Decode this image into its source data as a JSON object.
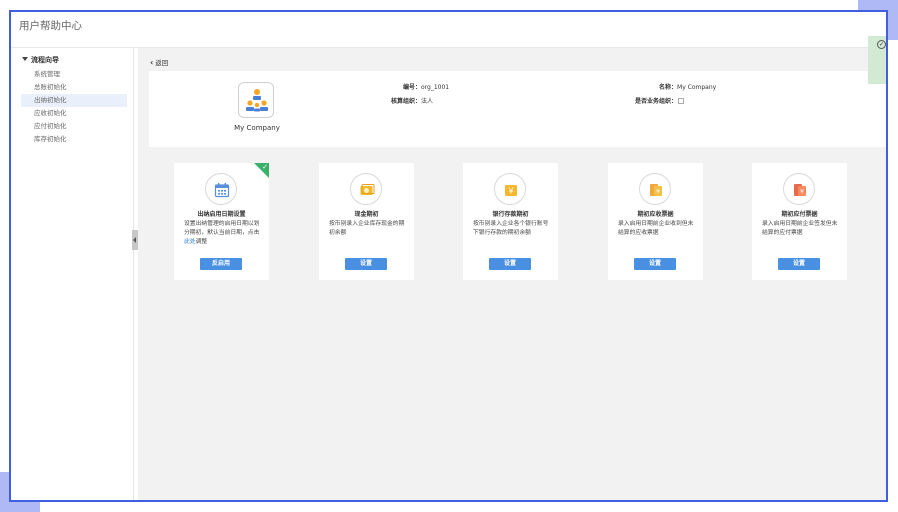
{
  "window": {
    "title": "用户帮助中心"
  },
  "sidebar": {
    "header": "流程向导",
    "items": [
      {
        "label": "系统管理",
        "active": false
      },
      {
        "label": "总账初始化",
        "active": false
      },
      {
        "label": "出纳初始化",
        "active": true
      },
      {
        "label": "应收初始化",
        "active": false
      },
      {
        "label": "应付初始化",
        "active": false
      },
      {
        "label": "库存初始化",
        "active": false
      }
    ]
  },
  "main": {
    "back_label": "返回",
    "company": {
      "name": "My Company",
      "code_label": "编号：",
      "code_value": "org_1001",
      "name_label": "名称：",
      "name_value": "My Company",
      "accounting_label": "核算组织：",
      "accounting_value": "法人",
      "business_label": "是否业务组织："
    },
    "cards": [
      {
        "title": "出纳启用日期设置",
        "desc_before": "设置出纳管理的启用日期以划分期初，默认当前日期，点击",
        "desc_link": "此处",
        "desc_after": "调整",
        "button": "反启用",
        "icon": "calendar-icon",
        "completed": true
      },
      {
        "title": "现金期初",
        "desc": "按币别录入企业库存现金的期初余额",
        "button": "设置",
        "icon": "cash-icon"
      },
      {
        "title": "银行存款期初",
        "desc": "按币别录入企业各个银行账号下银行存款的期初余额",
        "button": "设置",
        "icon": "bank-deposit-icon"
      },
      {
        "title": "期初应收票据",
        "desc": "录入启用日期前企业收到但未结算的应收票据",
        "button": "设置",
        "icon": "receivable-bill-icon"
      },
      {
        "title": "期初应付票据",
        "desc": "录入启用日期前企业签发但未结算的应付票据",
        "button": "设置",
        "icon": "payable-bill-icon"
      }
    ]
  },
  "colors": {
    "accent": "#4a90e2",
    "frame": "#3f5fe0",
    "completed": "#3bb06a",
    "background": "#f2f2f2"
  }
}
